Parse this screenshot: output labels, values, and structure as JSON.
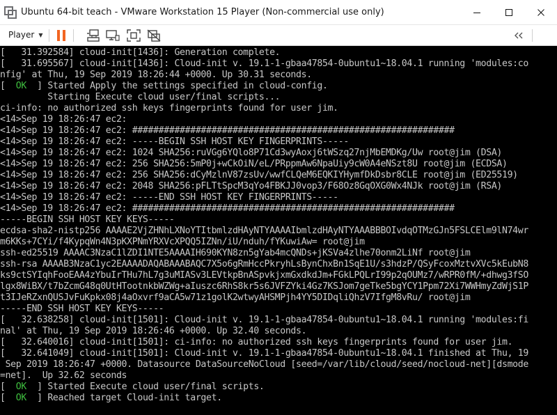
{
  "window": {
    "title": "Ubuntu 64-bit teach - VMware Workstation 15 Player (Non-commercial use only)"
  },
  "toolbar": {
    "player_menu_label": "Player",
    "icons": [
      "pause-icon",
      "send-ctrl-alt-del-icon",
      "removable-devices-icon",
      "fullscreen-icon",
      "unity-icon",
      "collapse-toolbar-icon"
    ]
  },
  "colors": {
    "console_bg": "#000000",
    "console_text": "#c7c7c7",
    "ok_green": "#3fbf3f",
    "pause_orange": "#f26522"
  },
  "console": {
    "lines": [
      {
        "pre": "[   31.392584] cloud-init[1436]: Generation complete."
      },
      {
        "pre": "[   31.695567] cloud-init[1436]: Cloud-init v. 19.1-1-gbaa47854-0ubuntu1~18.04.1 running 'modules:co"
      },
      {
        "pre": "nfig' at Thu, 19 Sep 2019 18:26:44 +0000. Up 30.31 seconds."
      },
      {
        "pre": "[  ",
        "ok": "OK",
        "post": "  ] Started Apply the settings specified in cloud-config."
      },
      {
        "pre": "         Starting Execute cloud user/final scripts..."
      },
      {
        "pre": "ci-info: no authorized ssh keys fingerprints found for user jim."
      },
      {
        "pre": "<14>Sep 19 18:26:47 ec2:"
      },
      {
        "pre": "<14>Sep 19 18:26:47 ec2: #############################################################"
      },
      {
        "pre": "<14>Sep 19 18:26:47 ec2: -----BEGIN SSH HOST KEY FINGERPRINTS-----"
      },
      {
        "pre": "<14>Sep 19 18:26:47 ec2: 1024 SHA256:ruVGg6YQlo8P71Cd3wyAoxj6tWSzq27njMbEMDKg/Uw root@jim (DSA)"
      },
      {
        "pre": "<14>Sep 19 18:26:47 ec2: 256 SHA256:5mP0j+wCkOiN/eL/PRppmAw6NpaUiy9cW0A4eNSzt8U root@jim (ECDSA)"
      },
      {
        "pre": "<14>Sep 19 18:26:47 ec2: 256 SHA256:dCyMzlnV87zsUv/wwfCLQeM6EQKIYHymfDkDsbr8CLE root@jim (ED25519)"
      },
      {
        "pre": "<14>Sep 19 18:26:47 ec2: 2048 SHA256:pFLTtSpcM3qYo4FBKJJ0vop3/F68Oz8GqOXG0Wx4NJk root@jim (RSA)"
      },
      {
        "pre": "<14>Sep 19 18:26:47 ec2: -----END SSH HOST KEY FINGERPRINTS-----"
      },
      {
        "pre": "<14>Sep 19 18:26:47 ec2: #############################################################"
      },
      {
        "pre": "-----BEGIN SSH HOST KEY KEYS-----"
      },
      {
        "pre": "ecdsa-sha2-nistp256 AAAAE2VjZHNhLXNoYTItbmlzdHAyNTYAAAAIbmlzdHAyNTYAAABBBOIvdqOTMzGJn5FSLCElm9lN74wr"
      },
      {
        "pre": "m6KKs+7CYi/f4KypqWn4N3pKXPNmYRXVcXPQQ5IZNn/iU/nduh/fYKuwiAw= root@jim"
      },
      {
        "pre": "ssh-ed25519 AAAAC3NzaC1lZDI1NTE5AAAAIH690KYN8zn5gYab4mcQNDs+jKSVa4zlhe70onm2LiNf root@jim"
      },
      {
        "pre": "ssh-rsa AAAAB3NzaC1yc2EAAAADAQABAAABAQC7X5o6gRmHccPkryhLsBynChxBn1SqE1U/s3hdzP/QSyFcoxMztvXVc5kEubN8"
      },
      {
        "pre": "ks9ctSYIqhFooEAA4zYbuIrTHu7hL7g3uMIASv3LEVtkpBnASpvkjxmGxdkdJm+FGkLPQLrI99p2qOUMz7/wRPR0fM/+dhwg3fSO"
      },
      {
        "pre": "lgx8WiBX/t7bZcmG48q0UtHTootnkbWZWg+aIuszc6RhS8kr5s6JVFZYki4Gz7KSJom7geTke5bgYCY1Ppm72Xi7WWHmyZdWjS1P"
      },
      {
        "pre": "t3IJeRZxnQUSJvFuKpkx08j4aOxvrf9aCA5w71z1golK2wtwyAHSMPjh4YY5DIDqliQhzV7IfgM8vRu/ root@jim"
      },
      {
        "pre": "-----END SSH HOST KEY KEYS-----"
      },
      {
        "pre": "[   32.638258] cloud-init[1501]: Cloud-init v. 19.1-1-gbaa47854-0ubuntu1~18.04.1 running 'modules:fi"
      },
      {
        "pre": "nal' at Thu, 19 Sep 2019 18:26:46 +0000. Up 32.40 seconds."
      },
      {
        "pre": "[   32.640016] cloud-init[1501]: ci-info: no authorized ssh keys fingerprints found for user jim."
      },
      {
        "pre": "[   32.641049] cloud-init[1501]: Cloud-init v. 19.1-1-gbaa47854-0ubuntu1~18.04.1 finished at Thu, 19"
      },
      {
        "pre": " Sep 2019 18:26:47 +0000. Datasource DataSourceNoCloud [seed=/var/lib/cloud/seed/nocloud-net][dsmode"
      },
      {
        "pre": "=net].  Up 32.62 seconds"
      },
      {
        "pre": "[  ",
        "ok": "OK",
        "post": "  ] Started Execute cloud user/final scripts."
      },
      {
        "pre": "[  ",
        "ok": "OK",
        "post": "  ] Reached target Cloud-init target."
      }
    ]
  }
}
